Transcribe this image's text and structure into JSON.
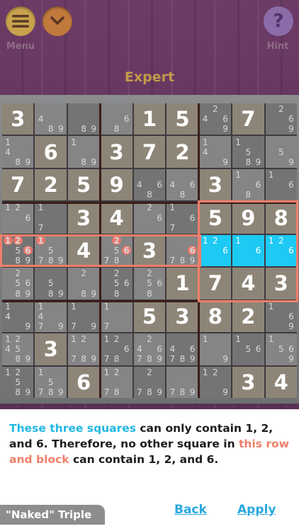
{
  "header": {
    "menu_label": "Menu",
    "hint_label": "Hint",
    "menu_icon": "hamburger-icon",
    "collapse_icon": "chevron-down-icon",
    "hint_icon": "question-icon",
    "hint_glyph": "?",
    "title": "Expert"
  },
  "colors": {
    "accent_blue": "#1ccaf3",
    "highlight_salmon": "#ef7f6a",
    "gold": "#c39a4a"
  },
  "board": {
    "rows": [
      [
        "3",
        {
          "c": [
            "4",
            "8",
            "9"
          ]
        },
        {
          "c": [
            "8",
            "9"
          ]
        },
        {
          "c": [
            "6",
            "8"
          ]
        },
        "1",
        "5",
        {
          "c": [
            "4",
            "2",
            "6",
            "9"
          ]
        },
        "7",
        {
          "c": [
            "2",
            "6",
            "9"
          ]
        }
      ],
      [
        {
          "c": [
            "1",
            "4",
            "8",
            "9"
          ]
        },
        "6",
        {
          "c": [
            "1",
            "8",
            "9"
          ]
        },
        "3",
        "7",
        "2",
        {
          "c": [
            "1",
            "4",
            "9"
          ]
        },
        {
          "c": [
            "1",
            "5",
            "8",
            "9"
          ]
        },
        {
          "c": [
            "5",
            "9"
          ]
        }
      ],
      [
        "7",
        "2",
        "5",
        "9",
        {
          "c": [
            "4",
            "6",
            "8"
          ]
        },
        {
          "c": [
            "4",
            "6",
            "8"
          ]
        },
        "3",
        {
          "c": [
            "1",
            "6",
            "8"
          ]
        },
        {
          "c": [
            "1",
            "6"
          ]
        }
      ],
      [
        {
          "c": [
            "1",
            "2",
            "6"
          ]
        },
        {
          "c": [
            "1",
            "7"
          ]
        },
        "3",
        "4",
        {
          "c": [
            "2",
            "6"
          ]
        },
        {
          "c": [
            "1",
            "6",
            "7"
          ]
        },
        "5",
        "9",
        "8"
      ],
      [
        {
          "c": [
            "1",
            "2",
            "5",
            "6",
            "8",
            "9"
          ]
        },
        {
          "c": [
            "1",
            "5",
            "7",
            "8",
            "9"
          ]
        },
        "4",
        {
          "c": [
            "2",
            "5",
            "6",
            "7",
            "8"
          ]
        },
        "3",
        {
          "c": [
            "6",
            "7",
            "8",
            "9"
          ]
        },
        {
          "c": [
            "1",
            "2",
            "6"
          ],
          "blue": true
        },
        {
          "c": [
            "1",
            "6"
          ],
          "blue": true
        },
        {
          "c": [
            "1",
            "2",
            "6"
          ],
          "blue": true
        }
      ],
      [
        {
          "c": [
            "2",
            "5",
            "6",
            "8",
            "9"
          ]
        },
        {
          "c": [
            "5",
            "8",
            "9"
          ]
        },
        {
          "c": [
            "2",
            "8",
            "9"
          ]
        },
        {
          "c": [
            "2",
            "5",
            "6",
            "8"
          ]
        },
        {
          "c": [
            "2",
            "5",
            "6",
            "8"
          ]
        },
        "1",
        "7",
        "4",
        "3"
      ],
      [
        {
          "c": [
            "1",
            "4",
            "9"
          ]
        },
        {
          "c": [
            "1",
            "4",
            "7",
            "9"
          ]
        },
        {
          "c": [
            "1",
            "7",
            "9"
          ]
        },
        {
          "c": [
            "1",
            "7"
          ]
        },
        "5",
        "3",
        "8",
        "2",
        {
          "c": [
            "1",
            "6",
            "9"
          ]
        }
      ],
      [
        {
          "c": [
            "1",
            "2",
            "4",
            "5",
            "8",
            "9"
          ]
        },
        "3",
        {
          "c": [
            "1",
            "2",
            "7",
            "8",
            "9"
          ]
        },
        {
          "c": [
            "1",
            "2",
            "6",
            "7",
            "8"
          ]
        },
        {
          "c": [
            "2",
            "4",
            "6",
            "7",
            "8",
            "9"
          ]
        },
        {
          "c": [
            "4",
            "6",
            "7",
            "8",
            "9"
          ]
        },
        {
          "c": [
            "1",
            "9"
          ]
        },
        {
          "c": [
            "1",
            "5",
            "6"
          ]
        },
        {
          "c": [
            "1",
            "5",
            "6",
            "9"
          ]
        }
      ],
      [
        {
          "c": [
            "1",
            "2",
            "5",
            "8",
            "9"
          ]
        },
        {
          "c": [
            "1",
            "5",
            "7",
            "8",
            "9"
          ]
        },
        "6",
        {
          "c": [
            "1",
            "2",
            "7",
            "8"
          ]
        },
        {
          "c": [
            "2",
            "7",
            "8",
            "9"
          ]
        },
        {
          "c": [
            "7",
            "8",
            "9"
          ]
        },
        {
          "c": [
            "1",
            "2",
            "9"
          ]
        },
        "3",
        "4"
      ]
    ]
  },
  "message": {
    "part1": "These three squares",
    "part2": " can only contain 1, 2, and 6. Therefore, no other square in ",
    "part3": "this row and block",
    "part4": " can contain 1, 2, and 6."
  },
  "footer": {
    "technique": "\"Naked\" Triple",
    "back": "Back",
    "apply": "Apply"
  }
}
